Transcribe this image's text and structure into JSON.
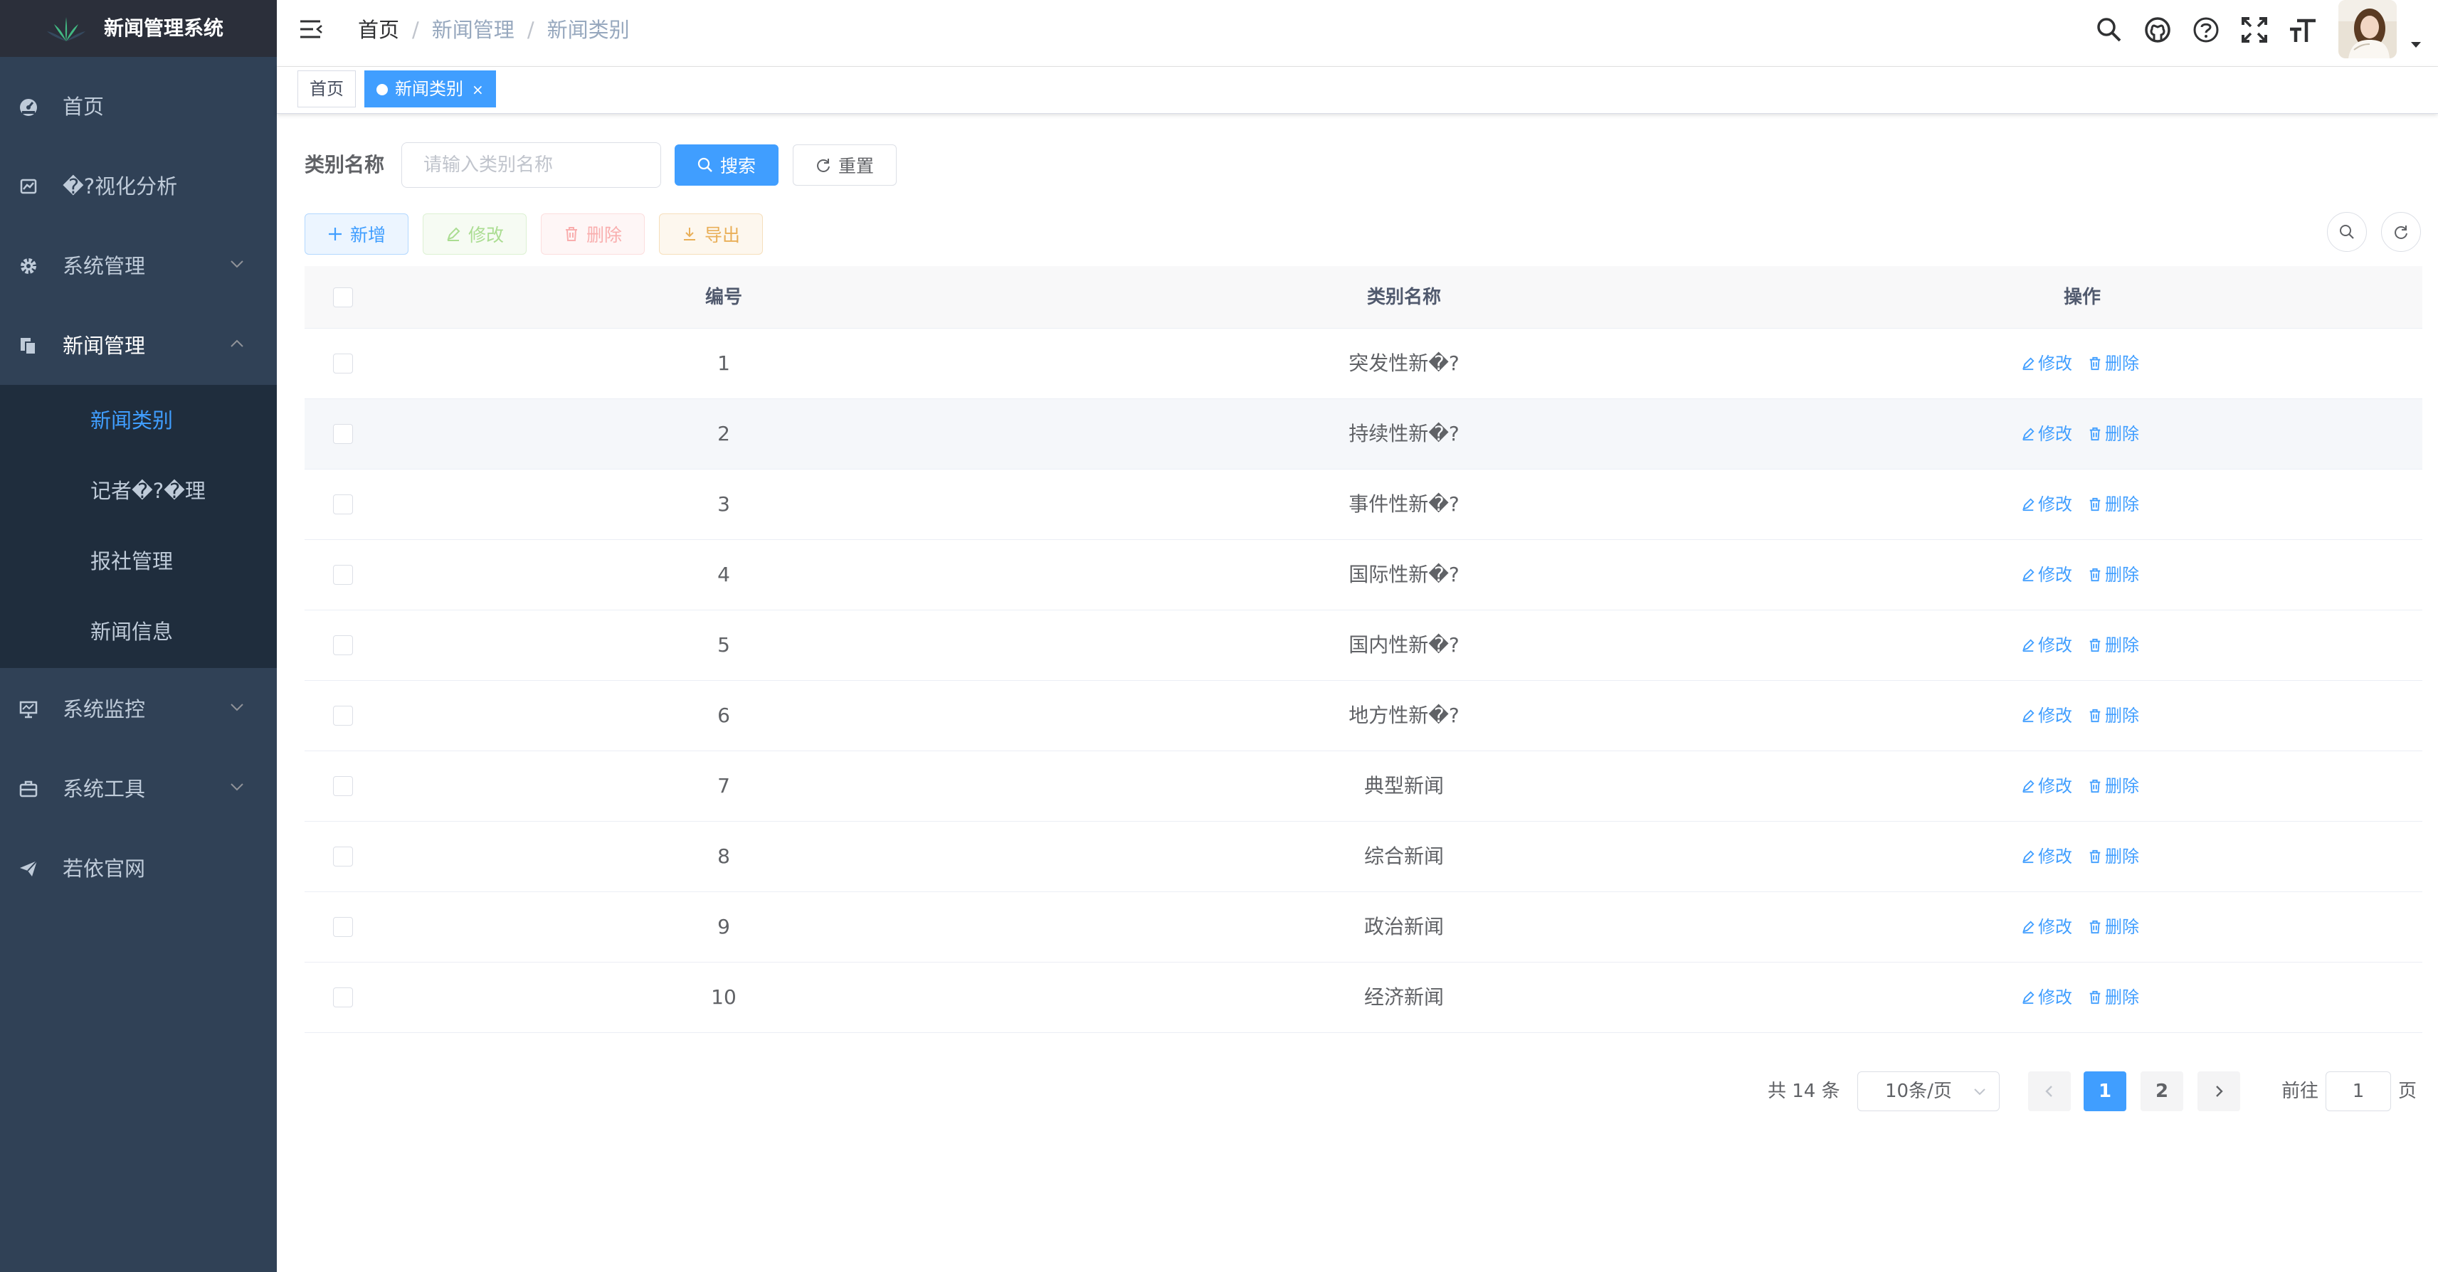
{
  "app": {
    "title": "新闻管理系统"
  },
  "sidebar": {
    "items": [
      {
        "label": "首页",
        "icon": "dashboard-icon"
      },
      {
        "label": "�?视化分析",
        "icon": "chart-icon"
      },
      {
        "label": "系统管理",
        "icon": "gear-icon"
      },
      {
        "label": "新闻管理",
        "icon": "documents-icon",
        "expanded": true
      },
      {
        "label": "系统监控",
        "icon": "monitor-icon"
      },
      {
        "label": "系统工具",
        "icon": "toolbox-icon"
      },
      {
        "label": "若依官网",
        "icon": "paper-plane-icon"
      }
    ],
    "submenu": [
      {
        "label": "新闻类别",
        "active": true
      },
      {
        "label": "记者�?�理"
      },
      {
        "label": "报社管理"
      },
      {
        "label": "新闻信息"
      }
    ]
  },
  "breadcrumb": [
    "首页",
    "新闻管理",
    "新闻类别"
  ],
  "tags": [
    {
      "label": "首页"
    },
    {
      "label": "新闻类别",
      "active": true,
      "close": "×"
    }
  ],
  "search": {
    "label": "类别名称",
    "placeholder": "请输入类别名称",
    "search_button": "搜索",
    "reset_button": "重置"
  },
  "toolbar": {
    "add": "新增",
    "edit": "修改",
    "delete": "删除",
    "export": "导出"
  },
  "table": {
    "columns": [
      "编号",
      "类别名称",
      "操作"
    ],
    "rows": [
      {
        "id": "1",
        "name": "突发性新�?"
      },
      {
        "id": "2",
        "name": "持续性新�?"
      },
      {
        "id": "3",
        "name": "事件性新�?"
      },
      {
        "id": "4",
        "name": "国际性新�?"
      },
      {
        "id": "5",
        "name": "国内性新�?"
      },
      {
        "id": "6",
        "name": "地方性新�?"
      },
      {
        "id": "7",
        "name": "典型新闻"
      },
      {
        "id": "8",
        "name": "综合新闻"
      },
      {
        "id": "9",
        "name": "政治新闻"
      },
      {
        "id": "10",
        "name": "经济新闻"
      }
    ],
    "row_actions": {
      "edit": "修改",
      "delete": "删除"
    }
  },
  "pagination": {
    "total": "共 14 条",
    "page_size": "10条/页",
    "pages": [
      "1",
      "2"
    ],
    "current": "1",
    "goto_label": "前往",
    "goto_value": "1",
    "page_suffix": "页"
  },
  "colors": {
    "primary": "#409eff",
    "sidebar": "#304156",
    "submenu": "#1f2d3d",
    "logo_bar": "#2b2f3a"
  }
}
